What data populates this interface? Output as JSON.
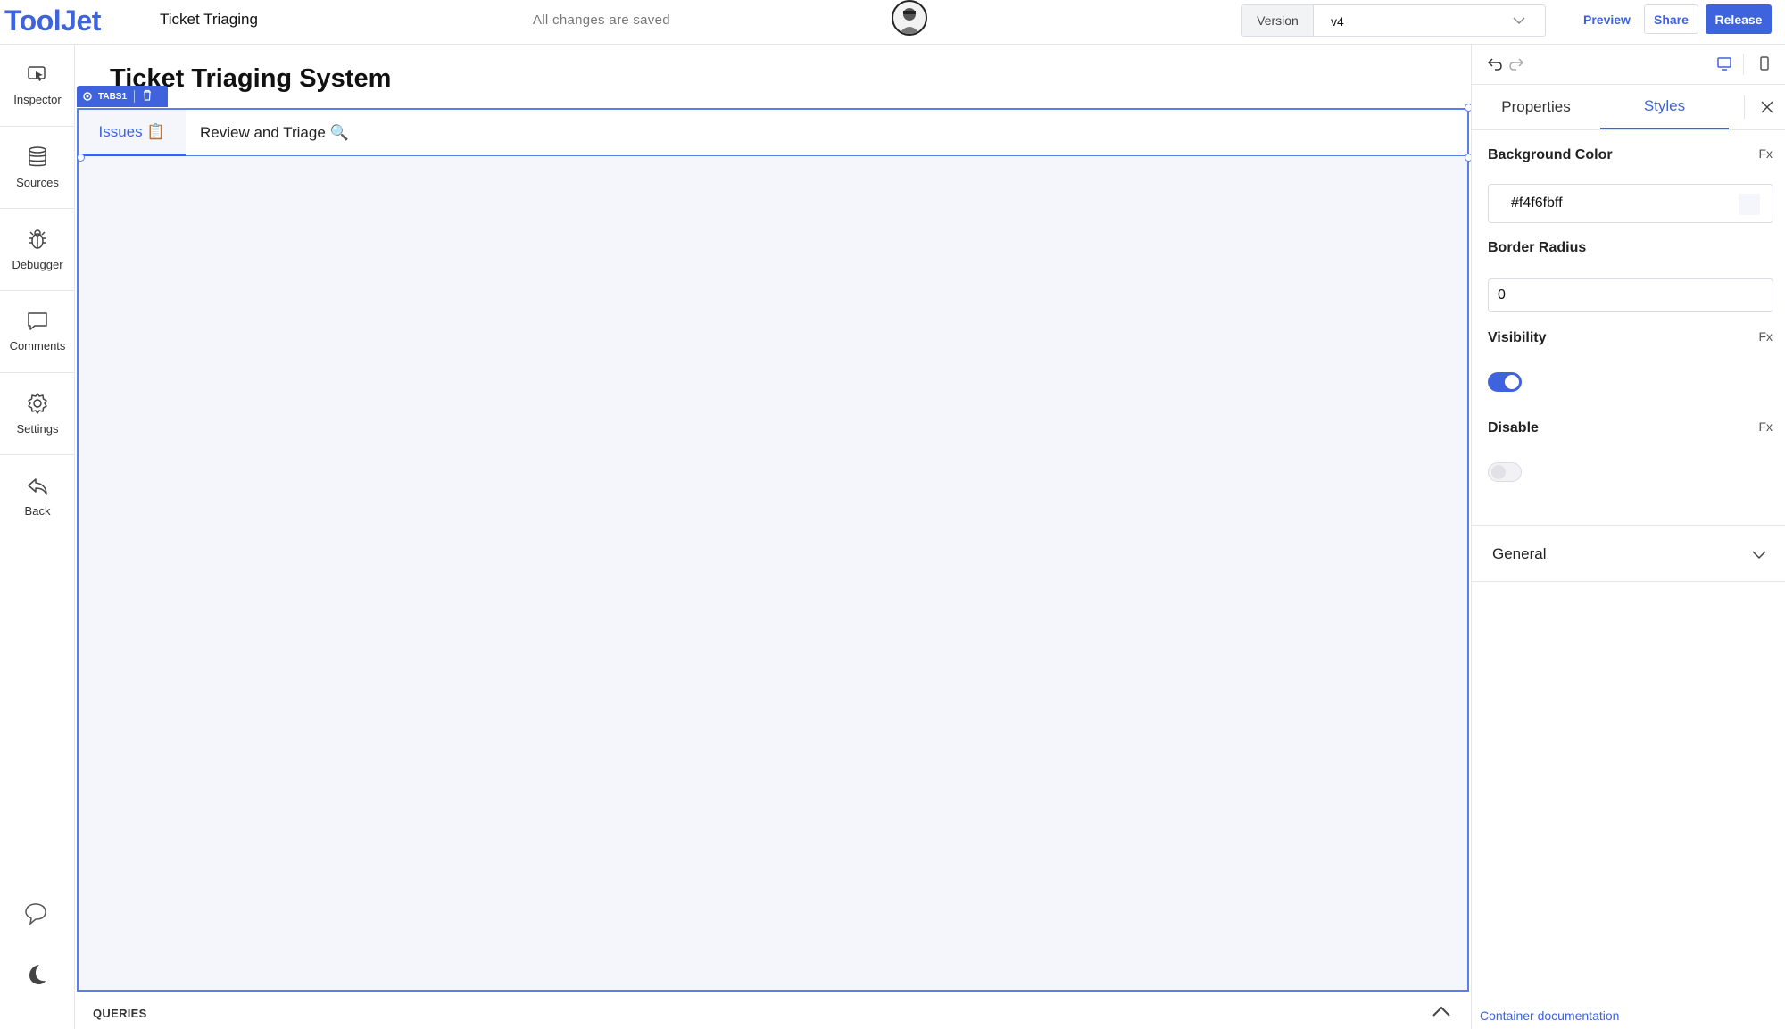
{
  "header": {
    "logo": "ToolJet",
    "app_name": "Ticket Triaging",
    "save_status": "All changes are saved",
    "version_label": "Version",
    "version_value": "v4",
    "preview_label": "Preview",
    "share_label": "Share",
    "release_label": "Release"
  },
  "sidebar": {
    "items": [
      {
        "label": "Inspector",
        "icon": "inspector-icon"
      },
      {
        "label": "Sources",
        "icon": "database-icon"
      },
      {
        "label": "Debugger",
        "icon": "bug-icon"
      },
      {
        "label": "Comments",
        "icon": "comment-icon"
      },
      {
        "label": "Settings",
        "icon": "gear-icon"
      },
      {
        "label": "Back",
        "icon": "back-arrow-icon"
      }
    ],
    "bottom_icons": [
      "chat-icon",
      "moon-icon"
    ]
  },
  "canvas": {
    "page_title": "Ticket Triaging System",
    "widget_label": "TABS1",
    "tabs": [
      {
        "label": "Issues 📋",
        "active": true
      },
      {
        "label": "Review and Triage 🔍",
        "active": false
      }
    ],
    "tab_background": "#f4f6fb"
  },
  "queries": {
    "label": "QUERIES"
  },
  "inspector_panel": {
    "tabs": [
      "Properties",
      "Styles"
    ],
    "active_tab": "Styles",
    "background_color_label": "Background Color",
    "background_color_value": "#f4f6fbff",
    "border_radius_label": "Border Radius",
    "border_radius_value": "0",
    "visibility_label": "Visibility",
    "visibility_on": true,
    "disable_label": "Disable",
    "disable_on": false,
    "fx_label": "Fx",
    "general_label": "General",
    "doc_link": "Container documentation"
  },
  "colors": {
    "accent": "#3e63dd",
    "canvas_bg": "#f4f6fb",
    "border": "#e6e6ea"
  }
}
